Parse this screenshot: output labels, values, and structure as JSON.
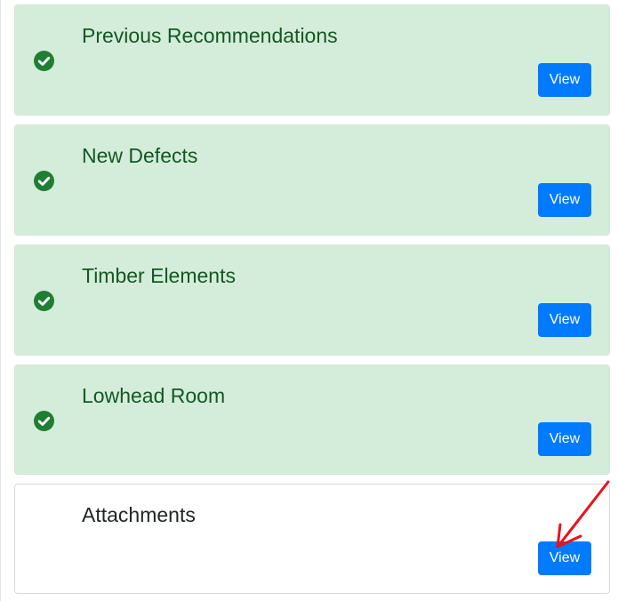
{
  "sections": [
    {
      "title": "Previous Recommendations",
      "completed": true,
      "button_label": "View"
    },
    {
      "title": "New Defects",
      "completed": true,
      "button_label": "View"
    },
    {
      "title": "Timber Elements",
      "completed": true,
      "button_label": "View"
    },
    {
      "title": "Lowhead Room",
      "completed": true,
      "button_label": "View"
    },
    {
      "title": "Attachments",
      "completed": false,
      "button_label": "View"
    }
  ],
  "icons": {
    "completed": "check-circle-icon",
    "annotation": "red-arrow-icon"
  },
  "colors": {
    "completed_bg": "#d4edda",
    "completed_text": "#155724",
    "check": "#1e7e34",
    "button": "#007bff",
    "annotation": "#e8141b"
  }
}
